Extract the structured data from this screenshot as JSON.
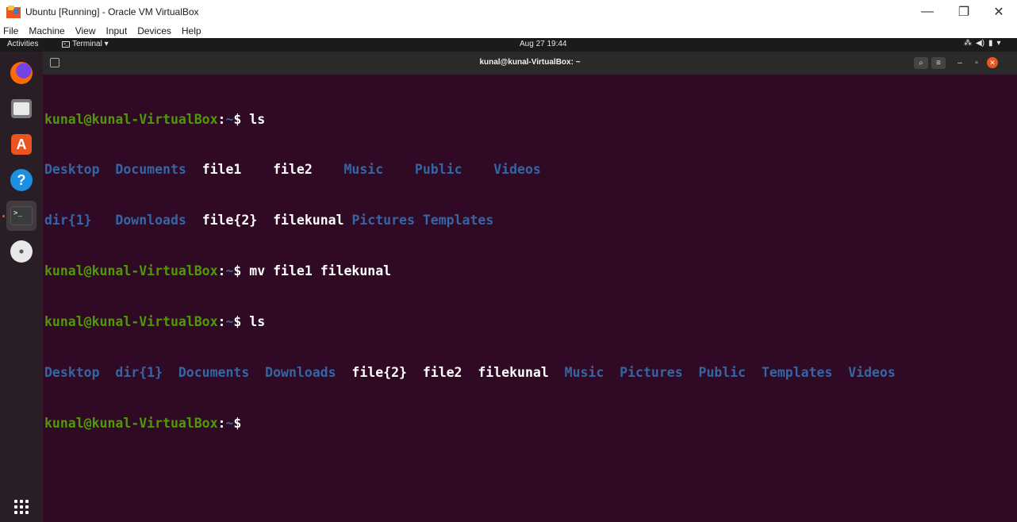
{
  "host_window": {
    "title": "Ubuntu [Running] - Oracle VM VirtualBox",
    "controls": {
      "minimize": "—",
      "maximize": "❐",
      "close": "✕"
    },
    "menu": [
      "File",
      "Machine",
      "View",
      "Input",
      "Devices",
      "Help"
    ]
  },
  "topbar": {
    "activities": "Activities",
    "app_menu": "Terminal ▾",
    "clock": "Aug 27  19:44",
    "status_icons": [
      "network-icon",
      "volume-icon",
      "battery-icon",
      "menu-arrow-icon"
    ]
  },
  "dock": {
    "items": [
      "Firefox",
      "Files",
      "Ubuntu Software",
      "Help",
      "Terminal",
      "DVD",
      "Show Applications"
    ]
  },
  "terminal": {
    "title": "kunal@kunal-VirtualBox: ~",
    "prompt": {
      "user": "kunal@kunal-VirtualBox",
      "colon": ":",
      "path": "~",
      "sign": "$ "
    },
    "lines": [
      {
        "cmd": "ls"
      },
      {
        "out1": "Desktop  Documents  ",
        "out2": "file1    file2    ",
        "out3": "Music    Public    Videos"
      },
      {
        "out1": "dir{1}   Downloads  ",
        "out2": "file{2}  filekunal ",
        "out3": "Pictures Templates"
      },
      {
        "cmd": "mv file1 filekunal"
      },
      {
        "cmd": "ls"
      },
      {
        "out1": "Desktop  dir{1}  Documents  Downloads  ",
        "out2": "file{2}  file2  filekunal  ",
        "out3": "Music  Pictures  Public  Templates  Videos"
      },
      {
        "cmd": ""
      }
    ]
  },
  "colors": {
    "terminal_bg": "#300a24",
    "prompt_user": "#4e9a06",
    "prompt_path": "#3465a4",
    "directory": "#3465a4",
    "file": "#ffffff",
    "accent": "#e95420"
  }
}
